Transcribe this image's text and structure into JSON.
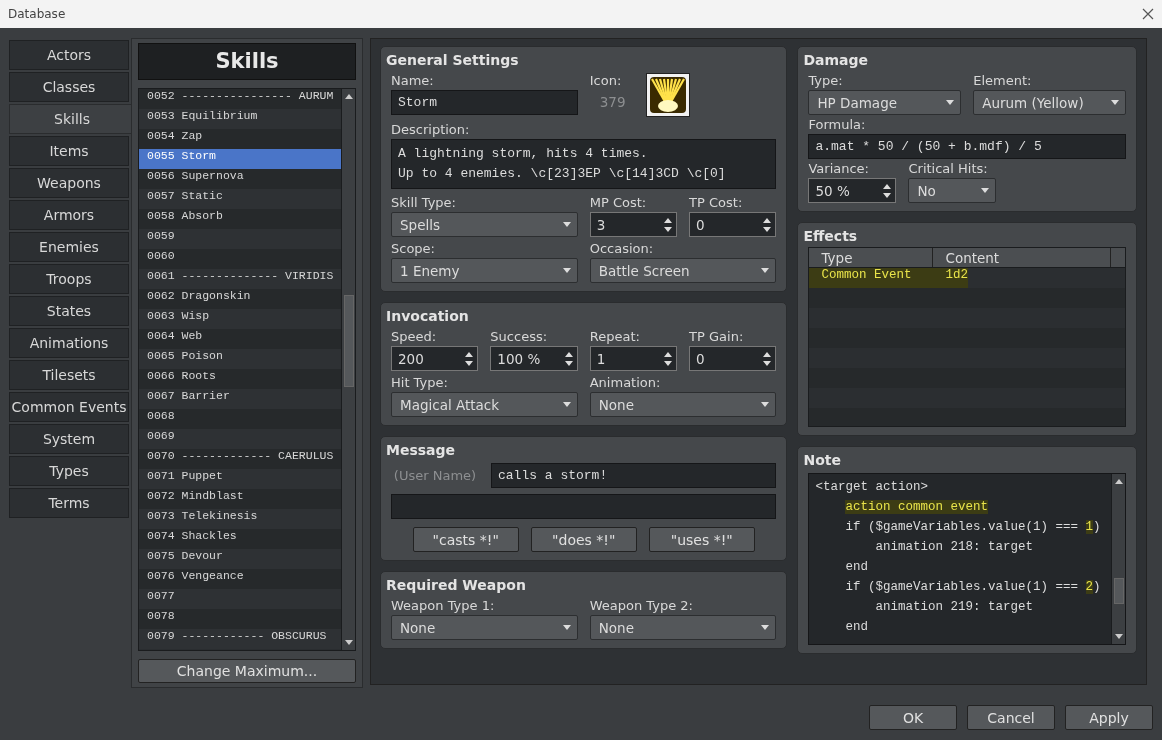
{
  "window": {
    "title": "Database"
  },
  "categories": [
    {
      "label": "Actors",
      "selected": false
    },
    {
      "label": "Classes",
      "selected": false
    },
    {
      "label": "Skills",
      "selected": true
    },
    {
      "label": "Items",
      "selected": false
    },
    {
      "label": "Weapons",
      "selected": false
    },
    {
      "label": "Armors",
      "selected": false
    },
    {
      "label": "Enemies",
      "selected": false
    },
    {
      "label": "Troops",
      "selected": false
    },
    {
      "label": "States",
      "selected": false
    },
    {
      "label": "Animations",
      "selected": false
    },
    {
      "label": "Tilesets",
      "selected": false
    },
    {
      "label": "Common Events",
      "selected": false
    },
    {
      "label": "System",
      "selected": false
    },
    {
      "label": "Types",
      "selected": false
    },
    {
      "label": "Terms",
      "selected": false
    }
  ],
  "skill_list": {
    "title": "Skills",
    "items": [
      {
        "id": "0052",
        "name": "---------------- AURUM",
        "selected": false
      },
      {
        "id": "0053",
        "name": "Equilibrium",
        "selected": false
      },
      {
        "id": "0054",
        "name": "Zap",
        "selected": false
      },
      {
        "id": "0055",
        "name": "Storm",
        "selected": true
      },
      {
        "id": "0056",
        "name": "Supernova",
        "selected": false
      },
      {
        "id": "0057",
        "name": "Static",
        "selected": false
      },
      {
        "id": "0058",
        "name": "Absorb",
        "selected": false
      },
      {
        "id": "0059",
        "selected": false
      },
      {
        "id": "0060",
        "selected": false
      },
      {
        "id": "0061",
        "name": "-------------- VIRIDIS",
        "selected": false
      },
      {
        "id": "0062",
        "name": "Dragonskin",
        "selected": false
      },
      {
        "id": "0063",
        "name": "Wisp",
        "selected": false
      },
      {
        "id": "0064",
        "name": "Web",
        "selected": false
      },
      {
        "id": "0065",
        "name": "Poison",
        "selected": false
      },
      {
        "id": "0066",
        "name": "Roots",
        "selected": false
      },
      {
        "id": "0067",
        "name": "Barrier",
        "selected": false
      },
      {
        "id": "0068",
        "selected": false
      },
      {
        "id": "0069",
        "selected": false
      },
      {
        "id": "0070",
        "name": "------------- CAERULUS",
        "selected": false
      },
      {
        "id": "0071",
        "name": "Puppet",
        "selected": false
      },
      {
        "id": "0072",
        "name": "Mindblast",
        "selected": false
      },
      {
        "id": "0073",
        "name": "Telekinesis",
        "selected": false
      },
      {
        "id": "0074",
        "name": "Shackles",
        "selected": false
      },
      {
        "id": "0075",
        "name": "Devour",
        "selected": false
      },
      {
        "id": "0076",
        "name": "Vengeance",
        "selected": false
      },
      {
        "id": "0077",
        "selected": false
      },
      {
        "id": "0078",
        "selected": false
      },
      {
        "id": "0079",
        "name": "------------ OBSCURUS",
        "selected": false
      }
    ],
    "button": "Change Maximum..."
  },
  "general_settings": {
    "title": "General Settings",
    "name": {
      "label": "Name:",
      "value": "Storm"
    },
    "icon": {
      "label": "Icon:",
      "index": "379"
    },
    "description": {
      "label": "Description:",
      "lines": [
        "A lightning storm, hits 4 times.",
        "Up to 4 enemies. \\c[23]3EP \\c[14]3CD \\c[0]"
      ]
    },
    "fields": [
      {
        "label": "Skill Type:",
        "kind": "dropdown",
        "value": "Spells"
      },
      {
        "label": "MP Cost:",
        "kind": "spinner",
        "value": "3"
      },
      {
        "label": "TP Cost:",
        "kind": "spinner",
        "value": "0"
      },
      {
        "label": "Scope:",
        "kind": "dropdown",
        "value": "1 Enemy"
      },
      {
        "label": "Occasion:",
        "kind": "dropdown",
        "value": "Battle Screen"
      }
    ]
  },
  "invocation": {
    "title": "Invocation",
    "fields": [
      {
        "label": "Speed:",
        "kind": "spinner",
        "value": "200"
      },
      {
        "label": "Success:",
        "kind": "spinner",
        "value": "100 %"
      },
      {
        "label": "Repeat:",
        "kind": "spinner",
        "value": "1"
      },
      {
        "label": "TP Gain:",
        "kind": "spinner",
        "value": "0"
      },
      {
        "label": "Hit Type:",
        "kind": "dropdown",
        "value": "Magical Attack"
      },
      {
        "label": "Animation:",
        "kind": "dropdown",
        "value": "None"
      }
    ]
  },
  "message": {
    "title": "Message",
    "user_name": "(User Name)",
    "line_1": "calls a storm!",
    "buttons": [
      "\"casts *!\"",
      "\"does *!\"",
      "\"uses *!\""
    ]
  },
  "required_weapon": {
    "title": "Required Weapon",
    "fields": [
      {
        "label": "Weapon Type 1:",
        "kind": "dropdown",
        "value": "None"
      },
      {
        "label": "Weapon Type 2:",
        "kind": "dropdown",
        "value": "None"
      }
    ]
  },
  "damage": {
    "title": "Damage",
    "type": {
      "label": "Type:",
      "value": "HP Damage"
    },
    "element": {
      "label": "Element:",
      "value": "Aurum (Yellow)"
    },
    "formula": {
      "label": "Formula:",
      "value": "a.mat * 50 / (50 + b.mdf) / 5"
    },
    "variance": {
      "label": "Variance:",
      "value": "50 %"
    },
    "critical_hits": {
      "label": "Critical Hits:",
      "value": "No"
    }
  },
  "effects": {
    "title": "Effects",
    "columns": [
      "Type",
      "Content"
    ],
    "rows": [
      {
        "type": "Common Event",
        "content": "1d2",
        "highlighted": true
      }
    ]
  },
  "note": {
    "title": "Note",
    "lines": [
      {
        "segments": [
          {
            "text": "<target action>",
            "highlighted": false
          }
        ],
        "children": [
          {
            "segments": [
              {
                "text": "action common event",
                "highlighted": true
              }
            ]
          },
          {
            "segments": [
              {
                "text": "if ($gameVariables.value(1) === ",
                "highlighted": false
              },
              {
                "text": "1",
                "highlighted": true
              },
              {
                "text": ")",
                "highlighted": false
              }
            ],
            "children": [
              {
                "segments": [
                  {
                    "text": "animation 218: target",
                    "highlighted": false
                  }
                ]
              }
            ]
          },
          {
            "segments": [
              {
                "text": "end",
                "highlighted": false
              }
            ]
          },
          {
            "segments": [
              {
                "text": "if ($gameVariables.value(1) === ",
                "highlighted": false
              },
              {
                "text": "2",
                "highlighted": true
              },
              {
                "text": ")",
                "highlighted": false
              }
            ],
            "children": [
              {
                "segments": [
                  {
                    "text": "animation 219: target",
                    "highlighted": false
                  }
                ]
              }
            ]
          },
          {
            "segments": [
              {
                "text": "end",
                "highlighted": false
              }
            ]
          }
        ]
      }
    ]
  },
  "footer_buttons": [
    "OK",
    "Cancel",
    "Apply"
  ]
}
